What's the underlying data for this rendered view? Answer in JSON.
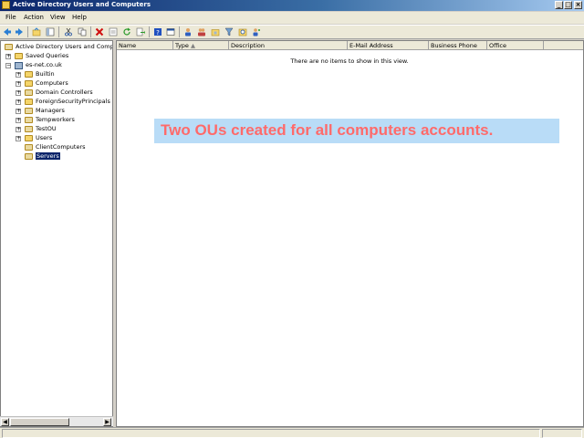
{
  "window": {
    "title": "Active Directory Users and Computers"
  },
  "menu": [
    "File",
    "Action",
    "View",
    "Help"
  ],
  "toolbar_icons": [
    "back-icon",
    "forward-icon",
    "up-icon",
    "show-hide-tree-icon",
    "cut-icon",
    "copy-icon",
    "delete-icon",
    "properties-icon",
    "refresh-icon",
    "export-list-icon",
    "help-icon",
    "new-window-icon",
    "new-user-icon",
    "new-group-icon",
    "new-ou-icon",
    "filter-icon",
    "find-icon",
    "add-to-group-icon"
  ],
  "tree": {
    "root": "Active Directory Users and Comput",
    "saved_queries": "Saved Queries",
    "domain": "es-net.co.uk",
    "containers": [
      "Builtin",
      "Computers",
      "Domain Controllers",
      "ForeignSecurityPrincipals",
      "Managers",
      "Tempworkers",
      "TestOU",
      "Users",
      "ClientComputers",
      "Servers"
    ],
    "selected": "Servers"
  },
  "list": {
    "columns": [
      "Name",
      "Type",
      "Description",
      "E-Mail Address",
      "Business Phone",
      "Office"
    ],
    "empty_message": "There are no items to show in this view."
  },
  "annotation": {
    "text": "Two OUs created for all computers accounts.",
    "text_color": "#ff6a6a",
    "bg_color": "#b9dcf7"
  }
}
